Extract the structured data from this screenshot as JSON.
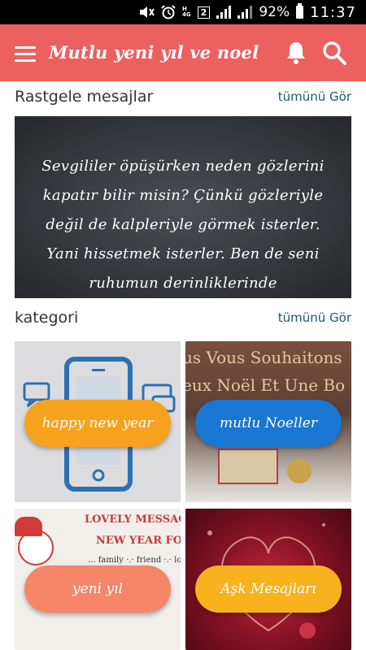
{
  "status_bar": {
    "network_label_top": "H",
    "network_label_bottom": "4G",
    "sim_badge": "2",
    "battery_percent": "92%",
    "time": "11:37"
  },
  "app_bar": {
    "title": "Mutlu yeni yıl ve noel",
    "menu_icon": "hamburger-menu-icon",
    "notification_icon": "bell-icon",
    "search_icon": "search-icon"
  },
  "random_messages": {
    "heading": "Rastgele mesajlar",
    "see_all": "tümünü Gör",
    "message": "Sevgililer öpüşürken neden gözlerini kapatır bilir misin? Çünkü gözleriyle değil de kalpleriyle görmek isterler. Yani hissetmek isterler. Ben de seni ruhumun derinliklerinde"
  },
  "categories": {
    "heading": "kategori",
    "see_all": "tümünü Gör",
    "items": [
      {
        "label": "happy new year",
        "color": "#f7a21c"
      },
      {
        "label": "mutlu Noeller",
        "color": "#1976d2"
      },
      {
        "label": "yeni yıl",
        "color": "#f5866a"
      },
      {
        "label": "Aşk Mesajları",
        "color": "#f7b21e"
      }
    ],
    "tile2_image_text_line1": "us Vous Souhaitons",
    "tile2_image_text_line2": "eux Noël Et Une Bo",
    "tile3_image_text_line1": "LOVELY MESSAGE",
    "tile3_image_text_line2": "NEW YEAR FOR :",
    "tile3_image_text_line3": "... family ·.· friend ·.· love"
  }
}
